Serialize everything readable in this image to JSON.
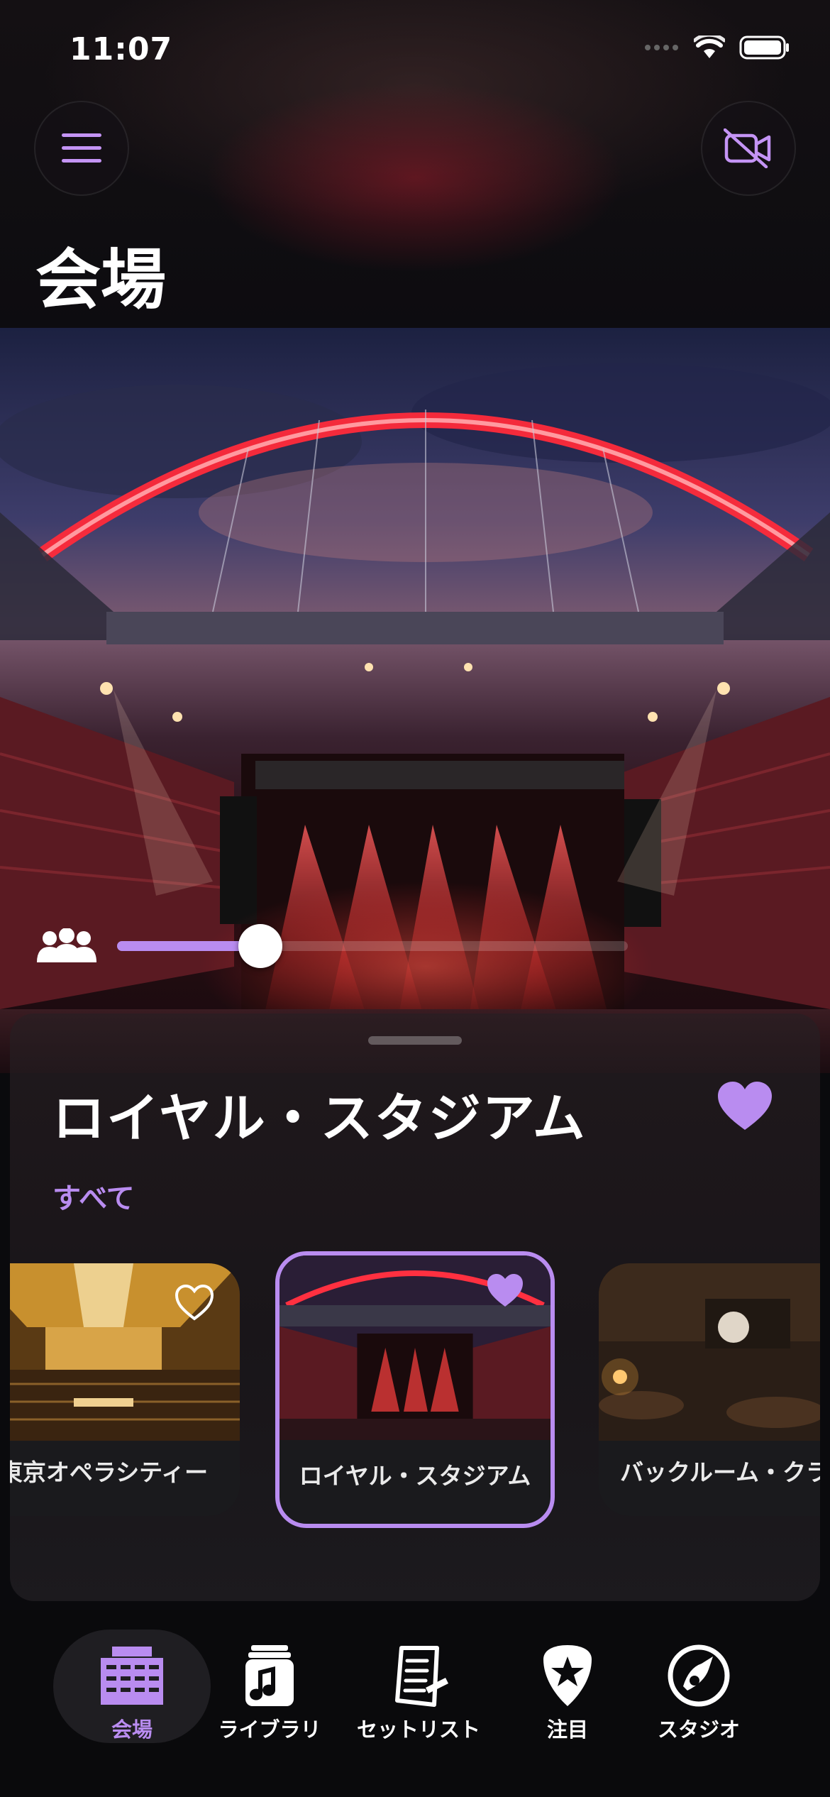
{
  "status_bar": {
    "time": "11:07"
  },
  "header": {
    "title": "会場"
  },
  "hero": {
    "crowd_level": 0.28
  },
  "sheet": {
    "venue_name": "ロイヤル・スタジアム",
    "favorite": true,
    "filter_label": "すべて",
    "cards": [
      {
        "label": "東京オペラシティー",
        "favorite": false
      },
      {
        "label": "ロイヤル・スタジアム",
        "favorite": true,
        "selected": true
      },
      {
        "label": "バックルーム・クラブ",
        "favorite": true
      }
    ]
  },
  "tabs": [
    {
      "label": "会場",
      "icon": "building-icon",
      "active": true
    },
    {
      "label": "ライブラリ",
      "icon": "music-note-icon"
    },
    {
      "label": "セットリスト",
      "icon": "setlist-icon"
    },
    {
      "label": "注目",
      "icon": "guitar-pick-star-icon"
    },
    {
      "label": "スタジオ",
      "icon": "studio-icon"
    }
  ],
  "colors": {
    "accent": "#b98cf0",
    "background": "#0a0a0d"
  }
}
